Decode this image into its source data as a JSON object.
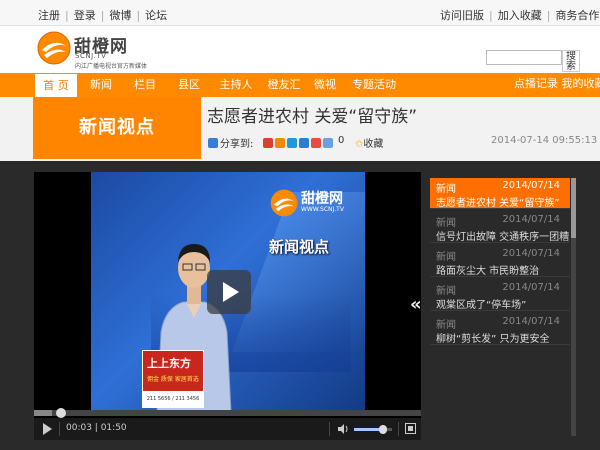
{
  "topbar": {
    "left_links": [
      "注册",
      "登录",
      "微博",
      "论坛"
    ],
    "right_links": [
      "访问旧版",
      "加入收藏",
      "商务合作"
    ]
  },
  "header": {
    "logo_title": "甜橙网",
    "logo_domain": "SCNJ.TV",
    "logo_tagline": "内江广播电视台官方新媒体",
    "search_button": "搜索"
  },
  "nav": {
    "items": [
      "首 页",
      "新闻",
      "栏目",
      "县区",
      "主持人",
      "橙友汇",
      "微视",
      "专题活动"
    ],
    "right_label": "点播记录 我的收藏"
  },
  "article": {
    "section": "新闻视点",
    "title": "志愿者进农村 关爱“留守族”",
    "share_label": "分享到:",
    "share_count": "0",
    "fav_label": "收藏",
    "datetime": "2014-07-14 09:55:13"
  },
  "player": {
    "screen_logo": "甜橙网",
    "screen_domain": "WWW.SCNJ.TV",
    "screen_show": "新闻视点",
    "board_line1": "上上东方",
    "board_line2": "佣金 质保 家居首选",
    "board_line3": "211 5656 / 211 3456",
    "progress": 0.033,
    "current_time": "00:03",
    "duration": "01:50",
    "volume": 0.75
  },
  "playlist": [
    {
      "category": "新闻",
      "date": "2014/07/14",
      "title": "志愿者进农村 关爱“留守族”",
      "active": true
    },
    {
      "category": "新闻",
      "date": "2014/07/14",
      "title": "信号灯出故障 交通秩序一团糟",
      "active": false
    },
    {
      "category": "新闻",
      "date": "2014/07/14",
      "title": "路面灰尘大 市民盼整治",
      "active": false
    },
    {
      "category": "新闻",
      "date": "2014/07/14",
      "title": "观棠区成了“停车场”",
      "active": false
    },
    {
      "category": "新闻",
      "date": "2014/07/14",
      "title": "柳树“剪长发” 只为更安全",
      "active": false
    }
  ],
  "colors": {
    "brand_orange": "#ff8a00",
    "dark_bg": "#2a2a2a",
    "active_item": "#ff6f00"
  }
}
